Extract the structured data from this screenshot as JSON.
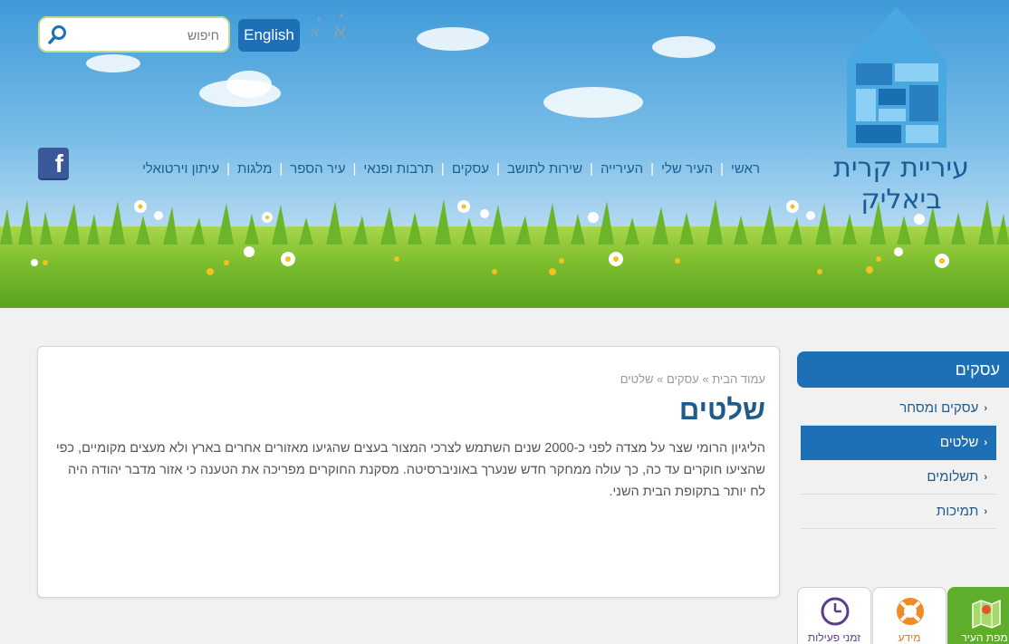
{
  "header": {
    "logo_title": "עיריית קרית ביאליק",
    "search": {
      "placeholder": "חיפוש",
      "value": ""
    },
    "english_label": "English",
    "font_small_label": "א",
    "font_large_label": "א",
    "main_nav": [
      "ראשי",
      "העיר שלי",
      "העירייה",
      "שירות לתושב",
      "עסקים",
      "תרבות ופנאי",
      "עיר הספר",
      "מלגות",
      "עיתון וירטואלי"
    ],
    "facebook_label": "f"
  },
  "content": {
    "breadcrumb": [
      "עמוד הבית",
      "עסקים",
      "שלטים"
    ],
    "breadcrumb_sep": "»",
    "title": "שלטים",
    "body": "הליגיון הרומי שצר על מצדה לפני כ-2000 שנים השתמש לצרכי המצור בעצים שהגיעו מאזורים אחרים בארץ ולא מעצים מקומיים, כפי שהציעו חוקרים עד כה, כך עולה ממחקר חדש שנערך באוניברסיטה. מסקנת החוקרים מפריכה את הטענה כי אזור מדבר יהודה היה לח יותר בתקופת הבית השני."
  },
  "sidebar": {
    "header": "עסקים",
    "items": [
      {
        "label": "עסקים ומסחר",
        "active": false
      },
      {
        "label": "שלטים",
        "active": true
      },
      {
        "label": "תשלומים",
        "active": false
      },
      {
        "label": "תמיכות",
        "active": false
      }
    ],
    "chevron": "‹"
  },
  "tiles": [
    {
      "label": "מפת העיר",
      "icon": "map-icon"
    },
    {
      "label": "מידע",
      "icon": "lifebuoy-icon"
    },
    {
      "label": "זמני פעילות",
      "icon": "clock-icon"
    }
  ],
  "colors": {
    "brand_blue": "#1d6fb6",
    "title_blue": "#1f5a8d",
    "green": "#5fae2b"
  }
}
